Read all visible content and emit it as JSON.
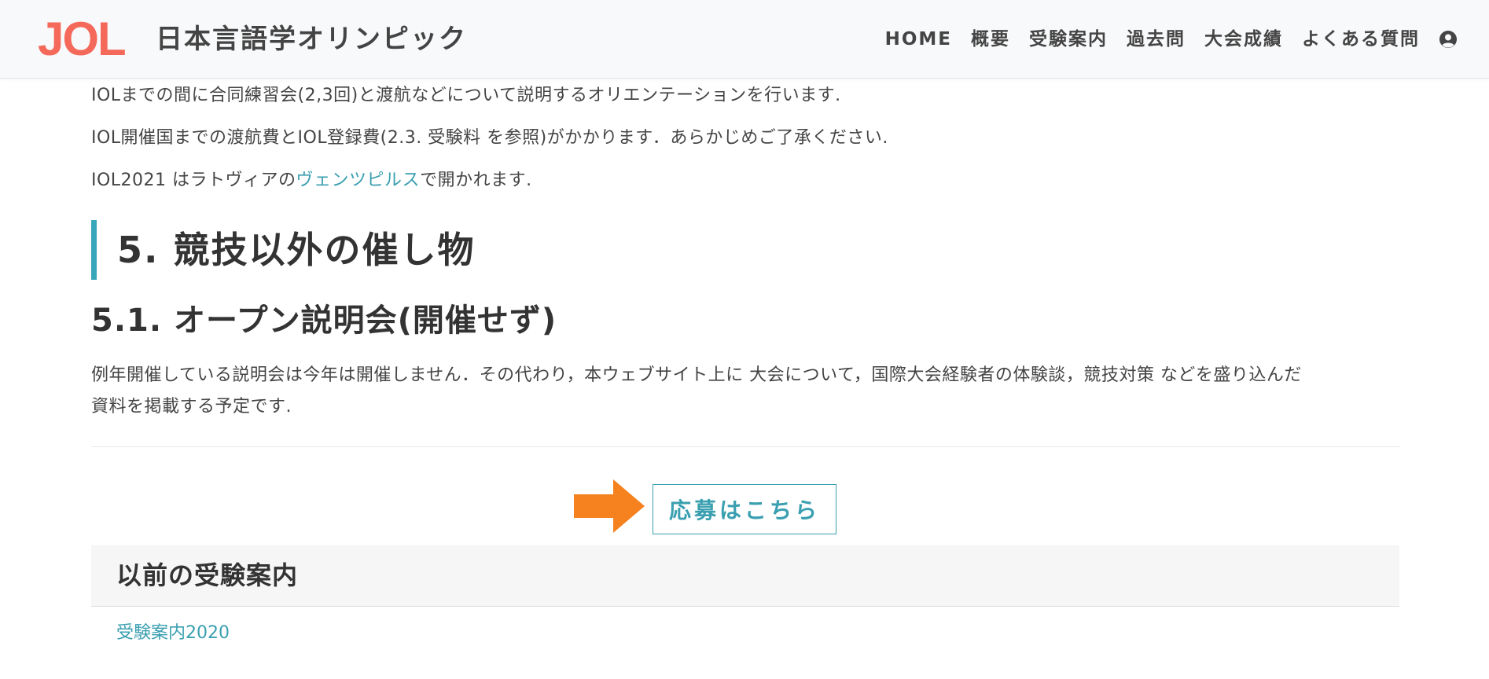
{
  "header": {
    "logo_text": "JOL",
    "site_title": "日本言語学オリンピック",
    "nav": [
      "HOME",
      "概要",
      "受験案内",
      "過去問",
      "大会成績",
      "よくある質問"
    ],
    "user_icon": "user-circle-icon",
    "colors": {
      "logo": "#f4695a",
      "background": "#f8f9fa"
    }
  },
  "content": {
    "para1": "IOLまでの間に合同練習会(2,3回)と渡航などについて説明するオリエンテーションを行います.",
    "para2": "IOL開催国までの渡航費とIOL登録費(2.3. 受験料 を参照)がかかります．あらかじめご了承ください.",
    "para3": {
      "before": "IOL2021 はラトヴィアの",
      "link": "ヴェンツピルス",
      "after": "で開かれます."
    },
    "section_heading": "5. 競技以外の催し物",
    "subsection_heading": "5.1. オープン説明会(開催せず)",
    "body_line1": "例年開催している説明会は今年は開催しません．その代わり，本ウェブサイト上に 大会について，国際大会経験者の体験談，競技対策 などを盛り込んだ",
    "body_line2": "資料を掲載する予定です.",
    "apply_button": "応募はこちら",
    "prev_section_title": "以前の受験案内",
    "prev_link": "受験案内2020",
    "colors": {
      "accent": "#3aa6b9",
      "arrow": "#f5821f"
    }
  }
}
